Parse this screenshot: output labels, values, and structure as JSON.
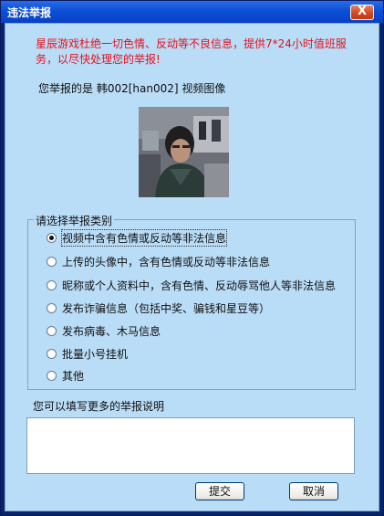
{
  "window": {
    "title": "违法举报",
    "close_label": "X"
  },
  "notice": "星辰游戏杜绝一切色情、反动等不良信息，提供7*24小时值班服务，以尽快处理您的举报!",
  "reported_target": "您举报的是 韩002[han002] 视频图像",
  "category_group": {
    "legend": "请选择举报类别",
    "options": [
      {
        "label": "视频中含有色情或反动等非法信息",
        "checked": true
      },
      {
        "label": "上传的头像中，含有色情或反动等非法信息",
        "checked": false
      },
      {
        "label": "昵称或个人资料中，含有色情、反动辱骂他人等非法信息",
        "checked": false
      },
      {
        "label": "发布诈骗信息（包括中奖、骗钱和星豆等）",
        "checked": false
      },
      {
        "label": "发布病毒、木马信息",
        "checked": false
      },
      {
        "label": "批量小号挂机",
        "checked": false
      },
      {
        "label": "其他",
        "checked": false
      }
    ]
  },
  "description": {
    "label": "您可以填写更多的举报说明",
    "value": ""
  },
  "buttons": {
    "submit": "提交",
    "cancel": "取消"
  },
  "colors": {
    "notice_text": "#e8101a",
    "client_background": "#b9dcf7",
    "titlebar": "#0b4fd6"
  }
}
